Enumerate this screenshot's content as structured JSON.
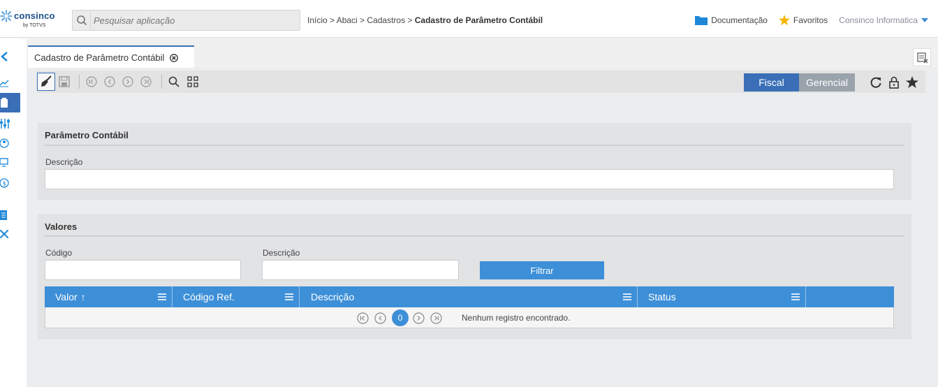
{
  "header": {
    "brand": "consinco",
    "brand_sub": "by TOTVS",
    "search_placeholder": "Pesquisar aplicação",
    "breadcrumb": {
      "trail": "Início > Abaci > Cadastros > ",
      "current": "Cadastro de Parâmetro Contábil"
    },
    "documentation": "Documentação",
    "favorites": "Favoritos",
    "user": "Consinco Informatica"
  },
  "tab": {
    "label": "Cadastro de Parâmetro Contábil"
  },
  "toolbar": {
    "fiscal": "Fiscal",
    "gerencial": "Gerencial"
  },
  "parametro": {
    "title": "Parâmetro Contábil",
    "descricao_label": "Descrição",
    "descricao_value": ""
  },
  "valores": {
    "title": "Valores",
    "codigo_label": "Código",
    "descricao_label": "Descrição",
    "filter_button": "Filtrar",
    "columns": [
      {
        "label": "Valor",
        "sort": "↑"
      },
      {
        "label": "Código Ref."
      },
      {
        "label": "Descrição"
      },
      {
        "label": "Status"
      }
    ],
    "current_page": "0",
    "empty_message": "Nenhum registro encontrado."
  },
  "colors": {
    "primary": "#3a6fb7",
    "grid_header": "#3d8fd8",
    "gerencial": "#9aa3ab",
    "favorite_star": "#f5b400",
    "folder": "#1e88d8"
  }
}
